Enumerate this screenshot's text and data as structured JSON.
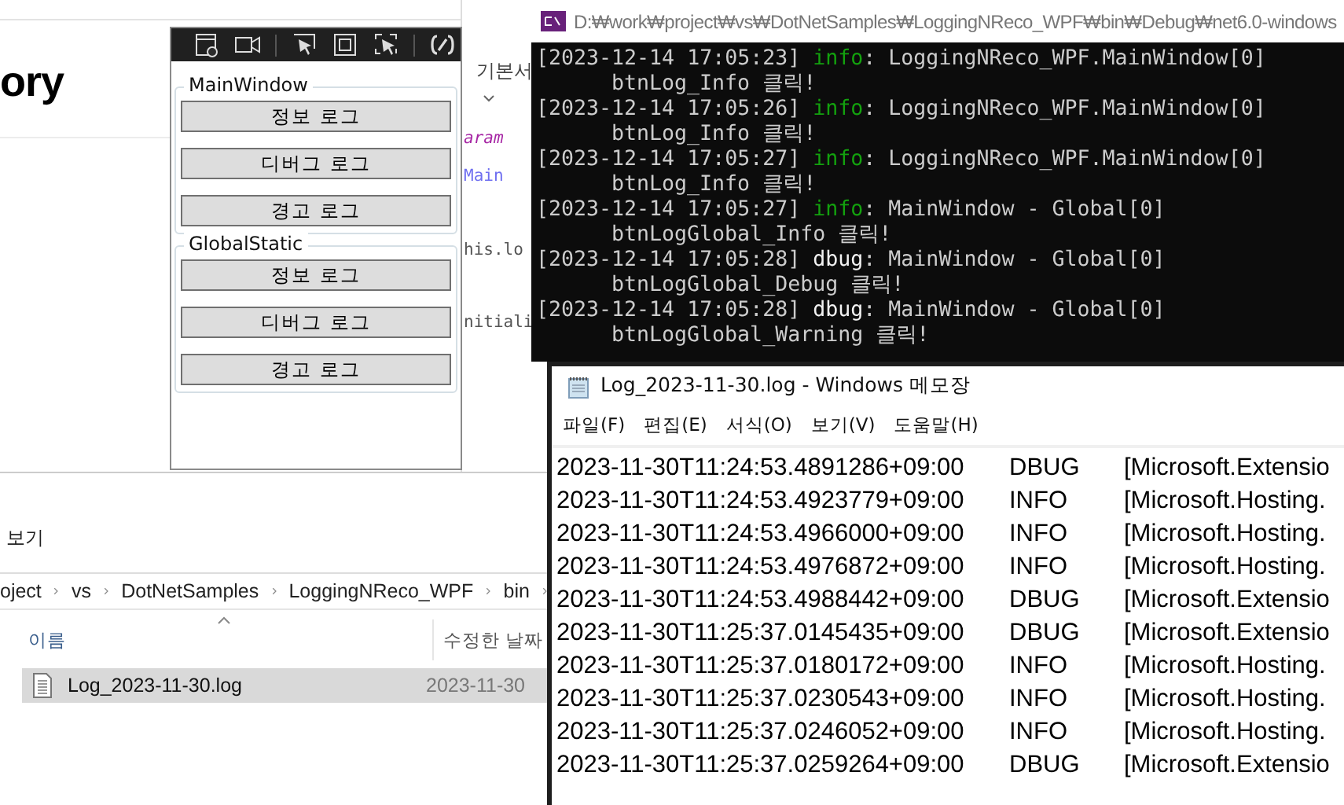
{
  "browser_page": {
    "heading": "ory"
  },
  "editor": {
    "tab_label": "기본서",
    "code_lines": [
      {
        "text": "aram",
        "kind": "keyword"
      },
      {
        "text": "Main",
        "kind": "type"
      },
      {
        "text": "his.lo",
        "kind": "plain"
      },
      {
        "text": "nitiali",
        "kind": "plain"
      }
    ]
  },
  "wpf_app": {
    "groups": [
      {
        "title": "MainWindow",
        "buttons": [
          "정보 로그",
          "디버그 로그",
          "경고 로그"
        ]
      },
      {
        "title": "GlobalStatic",
        "buttons": [
          "정보 로그",
          "디버그 로그",
          "경고 로그"
        ]
      }
    ]
  },
  "console": {
    "title": "D:₩work₩project₩vs₩DotNetSamples₩LoggingNReco_WPF₩bin₩Debug₩net6.0-windows",
    "entries": [
      {
        "time": "[2023-12-14 17:05:23]",
        "level": "info",
        "color": "#13a10e",
        "source": ": LoggingNReco_WPF.MainWindow[0]",
        "message": "btnLog_Info 클릭!"
      },
      {
        "time": "[2023-12-14 17:05:26]",
        "level": "info",
        "color": "#13a10e",
        "source": ": LoggingNReco_WPF.MainWindow[0]",
        "message": "btnLog_Info 클릭!"
      },
      {
        "time": "[2023-12-14 17:05:27]",
        "level": "info",
        "color": "#13a10e",
        "source": ": LoggingNReco_WPF.MainWindow[0]",
        "message": "btnLog_Info 클릭!"
      },
      {
        "time": "[2023-12-14 17:05:27]",
        "level": "info",
        "color": "#13a10e",
        "source": ": MainWindow - Global[0]",
        "message": "btnLogGlobal_Info 클릭!"
      },
      {
        "time": "[2023-12-14 17:05:28]",
        "level": "dbug",
        "color": "#f2f2f2",
        "source": ": MainWindow - Global[0]",
        "message": "btnLogGlobal_Debug 클릭!"
      },
      {
        "time": "[2023-12-14 17:05:28]",
        "level": "dbug",
        "color": "#f2f2f2",
        "source": ": MainWindow - Global[0]",
        "message": "btnLogGlobal_Warning 클릭!"
      }
    ]
  },
  "notepad": {
    "title": "Log_2023-11-30.log - Windows 메모장",
    "menu": [
      "파일(F)",
      "편집(E)",
      "서식(O)",
      "보기(V)",
      "도움말(H)"
    ],
    "rows": [
      [
        "2023-11-30T11:24:53.4891286+09:00",
        "DBUG",
        "[Microsoft.Extensio"
      ],
      [
        "2023-11-30T11:24:53.4923779+09:00",
        "INFO",
        "[Microsoft.Hosting."
      ],
      [
        "2023-11-30T11:24:53.4966000+09:00",
        "INFO",
        "[Microsoft.Hosting."
      ],
      [
        "2023-11-30T11:24:53.4976872+09:00",
        "INFO",
        "[Microsoft.Hosting."
      ],
      [
        "2023-11-30T11:24:53.4988442+09:00",
        "DBUG",
        "[Microsoft.Extensio"
      ],
      [
        "2023-11-30T11:25:37.0145435+09:00",
        "DBUG",
        "[Microsoft.Extensio"
      ],
      [
        "2023-11-30T11:25:37.0180172+09:00",
        "INFO",
        "[Microsoft.Hosting."
      ],
      [
        "2023-11-30T11:25:37.0230543+09:00",
        "INFO",
        "[Microsoft.Hosting."
      ],
      [
        "2023-11-30T11:25:37.0246052+09:00",
        "INFO",
        "[Microsoft.Hosting."
      ],
      [
        "2023-11-30T11:25:37.0259264+09:00",
        "DBUG",
        "[Microsoft.Extensio"
      ]
    ]
  },
  "explorer": {
    "menu": "보기",
    "breadcrumb": [
      "oject",
      "vs",
      "DotNetSamples",
      "LoggingNReco_WPF",
      "bin"
    ],
    "columns": [
      "이름",
      "수정한 날짜"
    ],
    "files": [
      {
        "name": "Log_2023-11-30.log",
        "date": "2023-11-30",
        "selected": true
      }
    ]
  }
}
